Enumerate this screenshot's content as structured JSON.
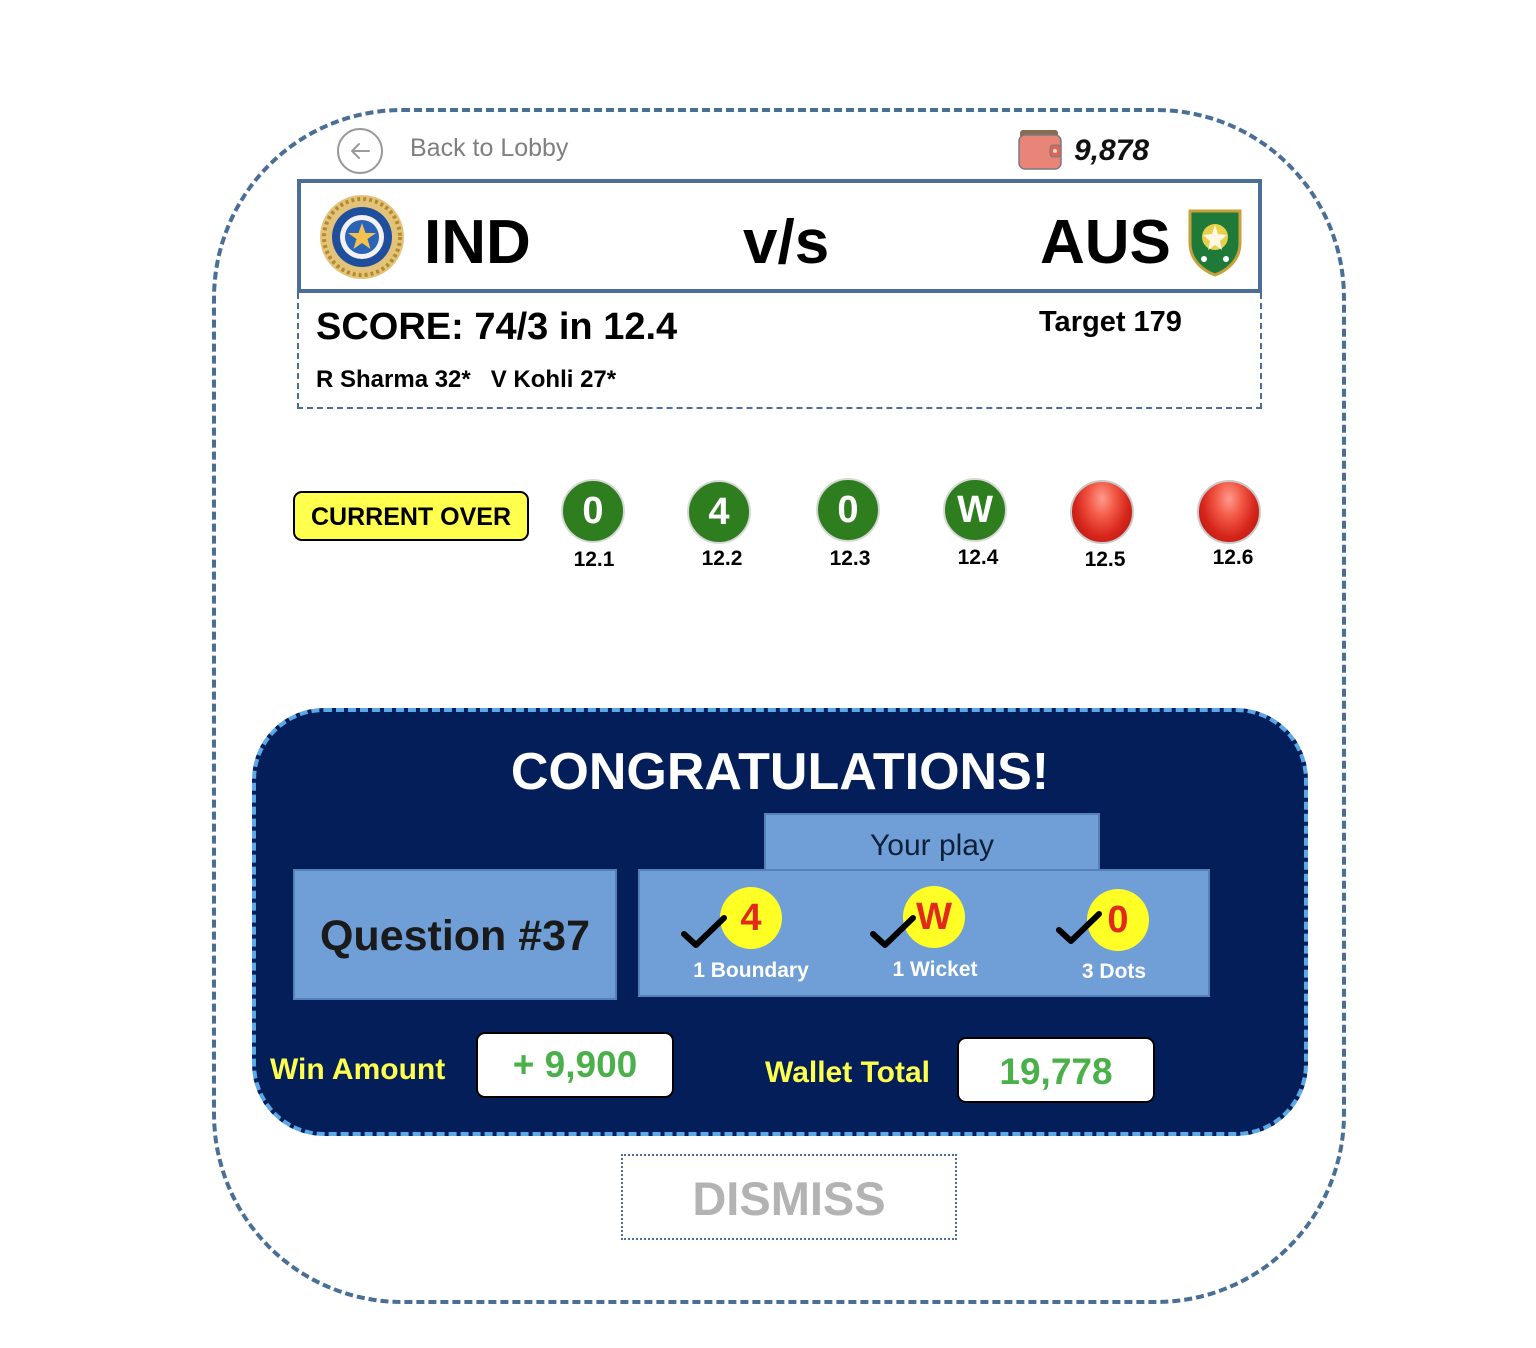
{
  "nav": {
    "back_label": "Back to Lobby"
  },
  "wallet": {
    "balance": "9,878"
  },
  "match": {
    "team_home": "IND",
    "versus": "v/s",
    "team_away": "AUS"
  },
  "score": {
    "line": "SCORE: 74/3 in 12.4",
    "target": "Target 179",
    "batsmen": "R Sharma 32*   V Kohli 27*"
  },
  "current_over": {
    "label": "CURRENT OVER",
    "balls": [
      {
        "result": "0",
        "ball": "12.1",
        "state": "played"
      },
      {
        "result": "4",
        "ball": "12.2",
        "state": "played"
      },
      {
        "result": "0",
        "ball": "12.3",
        "state": "played"
      },
      {
        "result": "W",
        "ball": "12.4",
        "state": "played"
      },
      {
        "result": "",
        "ball": "12.5",
        "state": "upcoming"
      },
      {
        "result": "",
        "ball": "12.6",
        "state": "upcoming"
      }
    ]
  },
  "result_popup": {
    "title": "CONGRATULATIONS!",
    "question": "Question #37",
    "your_play_label": "Your play",
    "picks": [
      {
        "value": "4",
        "label": "1 Boundary",
        "correct": true
      },
      {
        "value": "W",
        "label": "1 Wicket",
        "correct": true
      },
      {
        "value": "0",
        "label": "3 Dots",
        "correct": true
      }
    ],
    "win_label": "Win Amount",
    "win_amount": "+ 9,900",
    "wallet_label": "Wallet Total",
    "wallet_total": "19,778",
    "dismiss_label": "DISMISS"
  },
  "colors": {
    "frame": "#4a6f96",
    "panel": "#041e59",
    "panel_border": "#5aa9e6",
    "ball_green": "#2e7d1f",
    "highlight_yellow": "#ffff4d",
    "amount_green": "#4bb04a",
    "pick_red": "#e22a1b"
  },
  "icons": {
    "back": "arrow-left-circle-icon",
    "wallet": "wallet-icon",
    "home_logo": "bcci-logo-icon",
    "away_logo": "cricket-australia-logo-icon",
    "correct": "checkmark-icon",
    "upcoming_ball": "cricket-ball-icon"
  }
}
